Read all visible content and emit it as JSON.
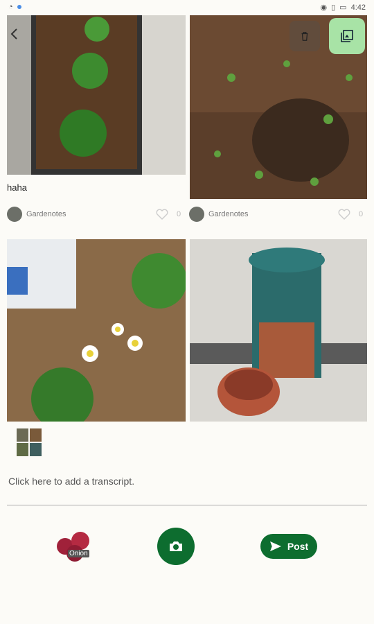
{
  "status_bar": {
    "time": "4:42"
  },
  "cards": [
    {
      "caption": "haha",
      "author": "Gardenotes",
      "likes": "0"
    },
    {
      "caption": "",
      "author": "Gardenotes",
      "likes": "0"
    },
    {
      "caption": "",
      "author": "",
      "likes": ""
    },
    {
      "caption": "",
      "author": "",
      "likes": ""
    }
  ],
  "composer": {
    "transcript_placeholder": "Click here to add a transcript.",
    "tag_label": "Onion",
    "post_label": "Post"
  },
  "colors": {
    "accent": "#0d6d2f",
    "gallery_button": "#a8e3a6"
  },
  "icons": [
    "back-icon",
    "trash-icon",
    "gallery-icon",
    "heart-icon",
    "camera-icon",
    "send-icon"
  ]
}
